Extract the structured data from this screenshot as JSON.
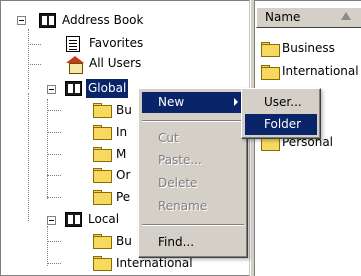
{
  "tree": {
    "root": "Address Book",
    "favorites": "Favorites",
    "all_users": "All Users",
    "global": "Global",
    "global_children": [
      "Bu",
      "In",
      "M",
      "Or",
      "Pe"
    ],
    "local": "Local",
    "local_children": [
      "Bu",
      "International"
    ]
  },
  "list": {
    "header": "Name",
    "items": [
      "Business",
      "International",
      "ed",
      "Personal"
    ]
  },
  "context_menu": {
    "new": "New",
    "cut": "Cut",
    "paste": "Paste...",
    "delete": "Delete",
    "rename": "Rename",
    "find": "Find..."
  },
  "submenu": {
    "user": "User...",
    "folder": "Folder"
  },
  "colors": {
    "selection": "#0a246a",
    "menu_bg": "#d4d0c8",
    "disabled_text": "#808080"
  }
}
